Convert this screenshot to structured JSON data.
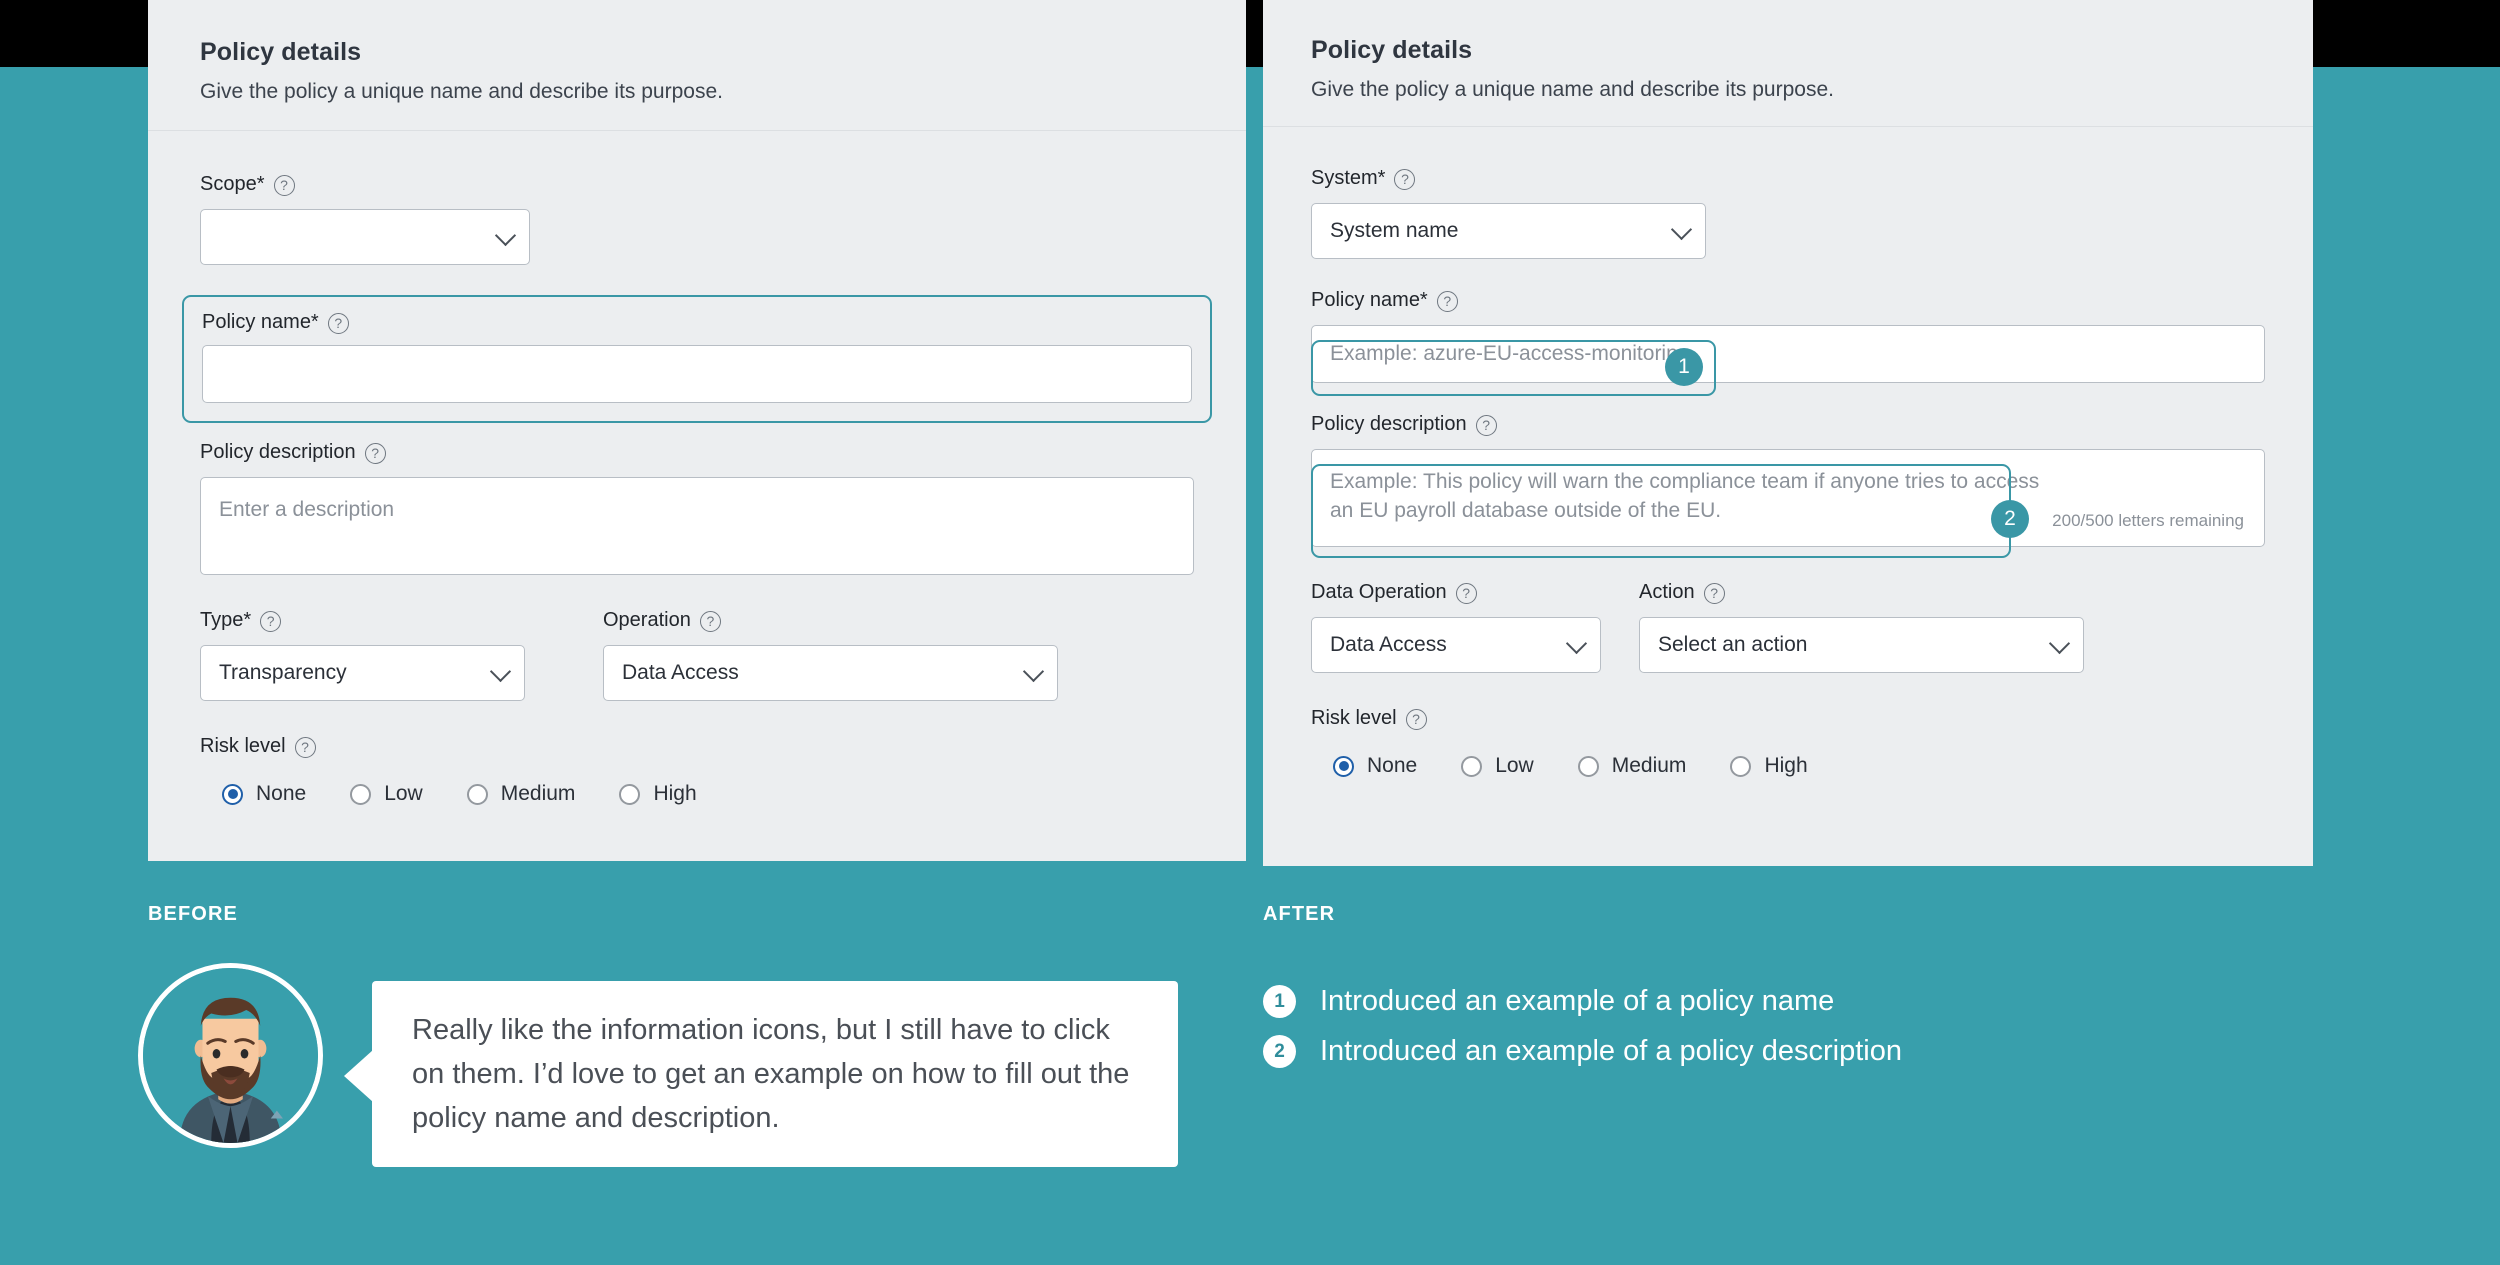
{
  "colors": {
    "background_teal": "#389fac",
    "panel_bg": "#eceef0",
    "accent_teal": "#3a97a6",
    "radio_blue": "#1f5fa9"
  },
  "before_panel": {
    "header": {
      "title": "Policy details",
      "subtitle": "Give the policy a unique name and describe its purpose."
    },
    "scope": {
      "label": "Scope*",
      "help": "?",
      "value": ""
    },
    "policy_name": {
      "label": "Policy name*",
      "help": "?",
      "value": ""
    },
    "policy_description": {
      "label": "Policy description",
      "help": "?",
      "placeholder": "Enter a description"
    },
    "type": {
      "label": "Type*",
      "help": "?",
      "value": "Transparency"
    },
    "operation": {
      "label": "Operation",
      "help": "?",
      "value": "Data Access"
    },
    "risk_level": {
      "label": "Risk level",
      "help": "?",
      "options": [
        {
          "label": "None",
          "selected": true
        },
        {
          "label": "Low",
          "selected": false
        },
        {
          "label": "Medium",
          "selected": false
        },
        {
          "label": "High",
          "selected": false
        }
      ]
    }
  },
  "after_panel": {
    "header": {
      "title": "Policy details",
      "subtitle": "Give the policy a unique name and describe its purpose."
    },
    "system": {
      "label": "System*",
      "help": "?",
      "value": "System name"
    },
    "policy_name": {
      "label": "Policy name*",
      "help": "?",
      "placeholder": "Example: azure-EU-access-monitoring",
      "badge": "1"
    },
    "policy_description": {
      "label": "Policy description",
      "help": "?",
      "placeholder": "Example: This policy will warn the compliance team if anyone tries to access an EU payroll database outside of the EU.",
      "counter": "200/500 letters remaining",
      "badge": "2"
    },
    "data_operation": {
      "label": "Data Operation",
      "help": "?",
      "value": "Data Access"
    },
    "action": {
      "label": "Action",
      "help": "?",
      "value": "Select an action"
    },
    "risk_level": {
      "label": "Risk level",
      "help": "?",
      "options": [
        {
          "label": "None",
          "selected": true
        },
        {
          "label": "Low",
          "selected": false
        },
        {
          "label": "Medium",
          "selected": false
        },
        {
          "label": "High",
          "selected": false
        }
      ]
    }
  },
  "bottom": {
    "before_label": "BEFORE",
    "after_label": "AFTER",
    "quote": "Really like the information icons, but I still have to click on them. I’d love to get an example on how to fill out the policy name and description.",
    "after_items": [
      {
        "num": "1",
        "text": "Introduced an example of a policy name"
      },
      {
        "num": "2",
        "text": "Introduced an example of a policy description"
      }
    ]
  }
}
